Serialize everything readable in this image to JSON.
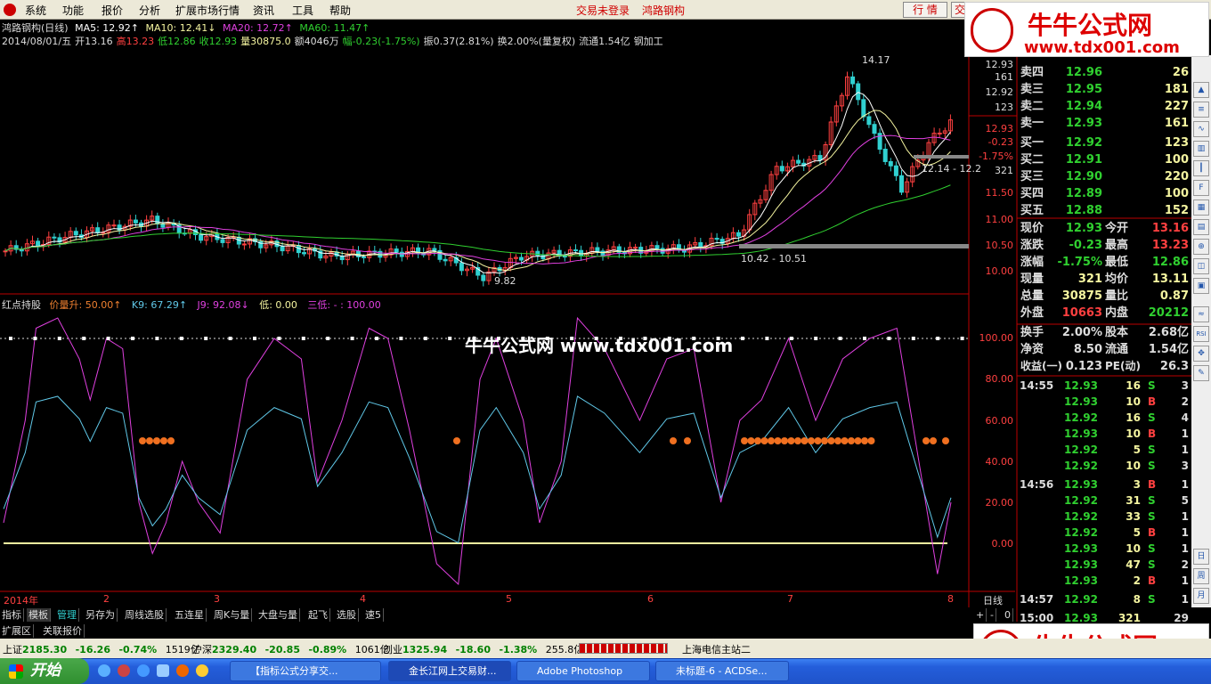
{
  "menu": {
    "items": [
      "系统",
      "功能",
      "报价",
      "分析",
      "扩展市场行情",
      "资讯",
      "工具",
      "帮助"
    ],
    "login": "交易未登录",
    "stock": "鸿路钢构",
    "quote_btn": "行 情",
    "trade_btn": "交"
  },
  "watermark": {
    "title": "牛牛公式网",
    "url": "www.tdx001.com",
    "center": "牛牛公式网 www.tdx001.com"
  },
  "info": {
    "line1": [
      "鸿路钢构(日线)",
      "MA5: 12.92↑",
      "MA10: 12.41↓",
      "MA20: 12.72↑",
      "MA60: 11.47↑"
    ],
    "line2": {
      "date": "2014/08/01/五",
      "open": "开13.16",
      "high": "高13.23",
      "low": "低12.86",
      "close": "收12.93",
      "vol": "量30875.0",
      "amt": "额4046万",
      "chg": "幅-0.23(-1.75%)",
      "amp": "振0.37(2.81%)",
      "turn": "换2.00%(量复权)",
      "flow": "流通1.54亿",
      "ind": "钢加工"
    }
  },
  "chart_labels": {
    "high": "14.17",
    "low": "9.82",
    "range1": "10.42 - 10.51",
    "range2": "12.14 - 12.2"
  },
  "price_axis": [
    "12.93",
    "161",
    "12.92",
    "123",
    "12.93",
    "-0.23",
    "-1.75%",
    "321",
    "11.50",
    "11.00",
    "10.50",
    "10.00"
  ],
  "indicator": {
    "name": "红点持股",
    "items": [
      "价量升: 50.00↑",
      "K9: 67.29↑",
      "J9: 92.08↓",
      "低: 0.00",
      "三低: - : 100.00"
    ]
  },
  "ind_axis": [
    "100.00",
    "80.00",
    "60.00",
    "40.00",
    "20.00",
    "0.00"
  ],
  "time_axis": [
    "2014年",
    "2",
    "3",
    "4",
    "5",
    "6",
    "7",
    "8"
  ],
  "period": "日线",
  "quotes": {
    "asks": [
      {
        "l": "卖四",
        "p": "12.96",
        "v": "26"
      },
      {
        "l": "卖三",
        "p": "12.95",
        "v": "181"
      },
      {
        "l": "卖二",
        "p": "12.94",
        "v": "227"
      },
      {
        "l": "卖一",
        "p": "12.93",
        "v": "161"
      }
    ],
    "bids": [
      {
        "l": "买一",
        "p": "12.92",
        "v": "123"
      },
      {
        "l": "买二",
        "p": "12.91",
        "v": "100"
      },
      {
        "l": "买三",
        "p": "12.90",
        "v": "220"
      },
      {
        "l": "买四",
        "p": "12.89",
        "v": "100"
      },
      {
        "l": "买五",
        "p": "12.88",
        "v": "152"
      }
    ],
    "stats": [
      [
        "现价",
        "12.93",
        "今开",
        "13.16"
      ],
      [
        "涨跌",
        "-0.23",
        "最高",
        "13.23"
      ],
      [
        "涨幅",
        "-1.75%",
        "最低",
        "12.86"
      ],
      [
        "现量",
        "321",
        "均价",
        "13.11"
      ],
      [
        "总量",
        "30875",
        "量比",
        "0.87"
      ],
      [
        "外盘",
        "10663",
        "内盘",
        "20212"
      ],
      [
        "换手",
        "2.00%",
        "股本",
        "2.68亿"
      ],
      [
        "净资",
        "8.50",
        "流通",
        "1.54亿"
      ],
      [
        "收益(一)",
        "0.123",
        "PE(动)",
        "26.3"
      ]
    ]
  },
  "ticks": [
    {
      "t": "14:55",
      "p": "12.93",
      "v": "16",
      "s": "S",
      "n": "3"
    },
    {
      "t": "",
      "p": "12.93",
      "v": "10",
      "s": "B",
      "n": "2"
    },
    {
      "t": "",
      "p": "12.92",
      "v": "16",
      "s": "S",
      "n": "4"
    },
    {
      "t": "",
      "p": "12.93",
      "v": "10",
      "s": "B",
      "n": "1"
    },
    {
      "t": "",
      "p": "12.92",
      "v": "5",
      "s": "S",
      "n": "1"
    },
    {
      "t": "",
      "p": "12.92",
      "v": "10",
      "s": "S",
      "n": "3"
    },
    {
      "t": "14:56",
      "p": "12.93",
      "v": "3",
      "s": "B",
      "n": "1"
    },
    {
      "t": "",
      "p": "12.92",
      "v": "31",
      "s": "S",
      "n": "5"
    },
    {
      "t": "",
      "p": "12.92",
      "v": "33",
      "s": "S",
      "n": "1"
    },
    {
      "t": "",
      "p": "12.92",
      "v": "5",
      "s": "B",
      "n": "1"
    },
    {
      "t": "",
      "p": "12.93",
      "v": "10",
      "s": "S",
      "n": "1"
    },
    {
      "t": "",
      "p": "12.93",
      "v": "47",
      "s": "S",
      "n": "2"
    },
    {
      "t": "",
      "p": "12.93",
      "v": "2",
      "s": "B",
      "n": "1"
    },
    {
      "t": "14:57",
      "p": "12.92",
      "v": "8",
      "s": "S",
      "n": "1"
    },
    {
      "t": "15:00",
      "p": "12.93",
      "v": "321",
      "s": "",
      "n": "29"
    }
  ],
  "bottom_tabs": [
    "指标",
    "模板",
    "管理",
    "另存为",
    "周线选股",
    "五连星",
    "周K与量",
    "大盘与量",
    "起飞",
    "选股",
    "速5"
  ],
  "bottom_tabs2": [
    "扩展区",
    "关联报价"
  ],
  "zoom": [
    "+",
    "-",
    "0"
  ],
  "status": {
    "sh": "上证",
    "sh_v": "2185.30",
    "sh_c": "-16.26",
    "sh_p": "-0.74%",
    "sh_a": "1519亿",
    "sz": "沪深",
    "sz_v": "2329.40",
    "sz_c": "-20.85",
    "sz_p": "-0.89%",
    "sz_a": "1061亿",
    "cy": "创业",
    "cy_v": "1325.94",
    "cy_c": "-18.60",
    "cy_p": "-1.38%",
    "cy_a": "255.8亿",
    "server": "上海电信主站二"
  },
  "taskbar": {
    "start": "开始",
    "tasks": [
      "【指标公式分享交...",
      "金长江网上交易财...",
      "Adobe Photoshop",
      "未标题-6 - ACDSe..."
    ]
  }
}
